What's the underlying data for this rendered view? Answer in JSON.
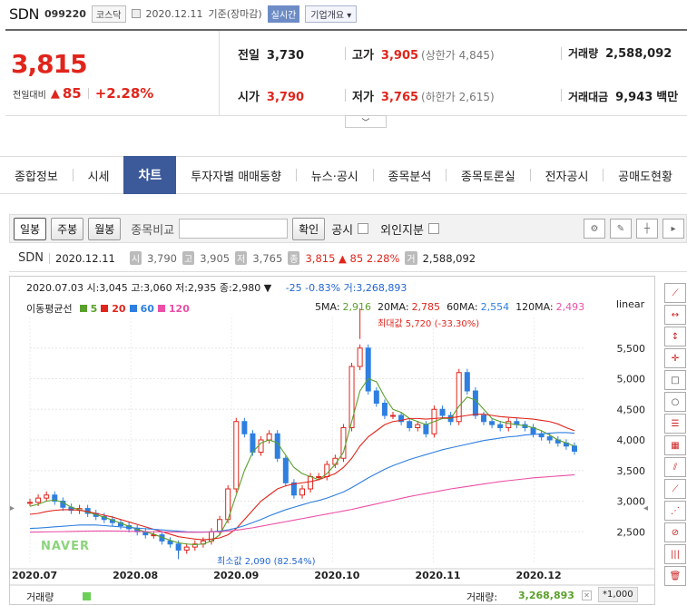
{
  "header": {
    "name": "SDN",
    "code": "099220",
    "market": "코스닥",
    "date": "2020.12.11",
    "basis": "기준(장마감)",
    "realtime": "실시간",
    "company_info": "기업개요"
  },
  "quote": {
    "price": "3,815",
    "change_label": "전일대비",
    "change_arrow": "▲",
    "change": "85",
    "change_pct": "+2.28%",
    "prev_label": "전일",
    "prev": "3,730",
    "high_label": "고가",
    "high": "3,905",
    "upper_limit": "(상한가 4,845)",
    "volume_label": "거래량",
    "volume": "2,588,092",
    "open_label": "시가",
    "open": "3,790",
    "low_label": "저가",
    "low": "3,765",
    "lower_limit": "(하한가 2,615)",
    "amount_label": "거래대금",
    "amount": "9,943",
    "amount_unit": "백만"
  },
  "tabs": [
    "종합정보",
    "시세",
    "차트",
    "투자자별 매매동향",
    "뉴스·공시",
    "종목분석",
    "종목토론실",
    "전자공시",
    "공매도현황"
  ],
  "active_tab": "차트",
  "toolbar": {
    "day": "일봉",
    "week": "주봉",
    "month": "월봉",
    "compare": "종목비교",
    "confirm": "확인",
    "notice": "공시",
    "foreign": "외인지분"
  },
  "info": {
    "name": "SDN",
    "date": "2020.12.11",
    "open_tag": "시",
    "open": "3,790",
    "high_tag": "고",
    "high": "3,905",
    "low_tag": "저",
    "low": "3,765",
    "close_tag": "종",
    "close": "3,815 ▲ 85 2.28%",
    "vol_tag": "거",
    "volume": "2,588,092"
  },
  "chart_header": {
    "ohlc": "2020.07.03 시:3,045 고:3,060 저:2,935 종:2,980 ▼",
    "change": "-25  -0.83% 거:3,268,893",
    "ma_label": "이동평균선",
    "ma_items": [
      {
        "label": "5",
        "color": "#5aa02c"
      },
      {
        "label": "20",
        "color": "#e0251c"
      },
      {
        "label": "60",
        "color": "#2e7fe0"
      },
      {
        "label": "120",
        "color": "#ec4fa6"
      }
    ],
    "ma5_label": "5MA:",
    "ma5": "2,916",
    "ma20_label": "20MA:",
    "ma20": "2,785",
    "ma60_label": "60MA:",
    "ma60": "2,554",
    "ma120_label": "120MA:",
    "ma120": "2,493",
    "scale": "linear",
    "max_note": "최대값 5,720 (-33.30%)",
    "min_note": "최소값 2,090 (82.54%)",
    "watermark": "NAVER",
    "volume_label": "거래량",
    "volume_readout_label": "거래량:",
    "volume_readout": "3,268,893",
    "unit": "*1,000"
  },
  "chart_data": {
    "type": "line",
    "x": [
      "2020.07",
      "2020.08",
      "2020.09",
      "2020.10",
      "2020.11",
      "2020.12"
    ],
    "ylim": [
      2000,
      6000
    ],
    "yticks": [
      2500,
      3000,
      3500,
      4000,
      4500,
      5000,
      5500
    ],
    "ytick_labels": [
      "2,500",
      "3,000",
      "3,500",
      "4,000",
      "4,500",
      "5,000",
      "5,500"
    ],
    "close": [
      2980,
      3050,
      3100,
      3000,
      2900,
      2850,
      2880,
      2800,
      2750,
      2700,
      2650,
      2600,
      2550,
      2500,
      2450,
      2450,
      2350,
      2300,
      2200,
      2250,
      2300,
      2350,
      2500,
      2700,
      3200,
      4300,
      4100,
      3800,
      4000,
      4100,
      3700,
      3300,
      3100,
      3200,
      3400,
      3400,
      3600,
      3700,
      4200,
      5200,
      5500,
      4800,
      4600,
      4400,
      4400,
      4300,
      4200,
      4250,
      4100,
      4500,
      4400,
      4300,
      5100,
      4800,
      4400,
      4300,
      4250,
      4200,
      4300,
      4250,
      4200,
      4100,
      4050,
      4000,
      3950,
      3900,
      3815
    ],
    "ma_series": [
      {
        "name": "5",
        "values": [
          2916,
          2950,
          3000,
          3020,
          2980,
          2900,
          2860,
          2820,
          2780,
          2740,
          2690,
          2640,
          2590,
          2540,
          2500,
          2460,
          2410,
          2360,
          2320,
          2300,
          2290,
          2300,
          2350,
          2450,
          2700,
          3100,
          3500,
          3800,
          3950,
          4000,
          3950,
          3750,
          3550,
          3450,
          3400,
          3350,
          3450,
          3600,
          3800,
          4300,
          4800,
          5000,
          4950,
          4700,
          4500,
          4450,
          4350,
          4300,
          4250,
          4300,
          4350,
          4350,
          4550,
          4700,
          4650,
          4500,
          4350,
          4300,
          4270,
          4250,
          4230,
          4200,
          4150,
          4080,
          4000,
          3950,
          3900
        ]
      },
      {
        "name": "20",
        "values": [
          2785,
          2800,
          2830,
          2850,
          2860,
          2860,
          2850,
          2830,
          2800,
          2770,
          2740,
          2700,
          2660,
          2620,
          2580,
          2540,
          2500,
          2460,
          2420,
          2400,
          2380,
          2370,
          2380,
          2400,
          2450,
          2550,
          2700,
          2850,
          3000,
          3100,
          3200,
          3250,
          3280,
          3300,
          3320,
          3350,
          3400,
          3450,
          3550,
          3700,
          3900,
          4050,
          4150,
          4250,
          4300,
          4320,
          4350,
          4350,
          4340,
          4350,
          4360,
          4360,
          4380,
          4400,
          4420,
          4420,
          4400,
          4380,
          4370,
          4360,
          4350,
          4340,
          4320,
          4300,
          4260,
          4200,
          4150
        ]
      },
      {
        "name": "60",
        "values": [
          2554,
          2560,
          2570,
          2580,
          2590,
          2600,
          2610,
          2610,
          2610,
          2600,
          2590,
          2580,
          2570,
          2560,
          2550,
          2540,
          2530,
          2520,
          2510,
          2500,
          2495,
          2495,
          2500,
          2510,
          2530,
          2560,
          2600,
          2650,
          2700,
          2760,
          2810,
          2860,
          2900,
          2940,
          2980,
          3010,
          3050,
          3100,
          3150,
          3220,
          3300,
          3380,
          3450,
          3520,
          3580,
          3630,
          3680,
          3720,
          3760,
          3800,
          3840,
          3870,
          3900,
          3930,
          3960,
          3990,
          4010,
          4030,
          4050,
          4060,
          4080,
          4090,
          4100,
          4110,
          4120,
          4120,
          4110
        ]
      },
      {
        "name": "120",
        "values": [
          2493,
          2495,
          2498,
          2500,
          2502,
          2505,
          2508,
          2510,
          2512,
          2512,
          2512,
          2510,
          2508,
          2505,
          2502,
          2500,
          2497,
          2495,
          2493,
          2492,
          2492,
          2493,
          2495,
          2500,
          2510,
          2525,
          2545,
          2565,
          2590,
          2615,
          2640,
          2665,
          2690,
          2715,
          2740,
          2765,
          2790,
          2815,
          2840,
          2865,
          2895,
          2925,
          2955,
          2985,
          3015,
          3045,
          3075,
          3100,
          3125,
          3150,
          3175,
          3200,
          3220,
          3240,
          3260,
          3280,
          3300,
          3320,
          3335,
          3350,
          3365,
          3380,
          3390,
          3400,
          3410,
          3420,
          3430
        ]
      }
    ]
  }
}
